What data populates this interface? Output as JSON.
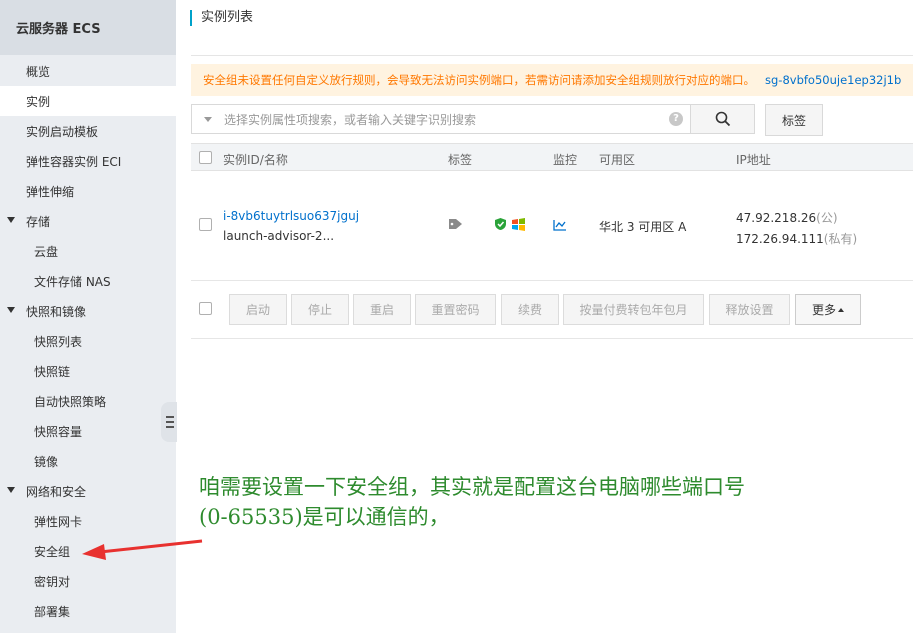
{
  "sidebar": {
    "title": "云服务器 ECS",
    "items": [
      {
        "label": "概览"
      },
      {
        "label": "实例"
      },
      {
        "label": "实例启动模板"
      },
      {
        "label": "弹性容器实例 ECI"
      },
      {
        "label": "弹性伸缩"
      },
      {
        "label": "存储"
      },
      {
        "label": "云盘"
      },
      {
        "label": "文件存储 NAS"
      },
      {
        "label": "快照和镜像"
      },
      {
        "label": "快照列表"
      },
      {
        "label": "快照链"
      },
      {
        "label": "自动快照策略"
      },
      {
        "label": "快照容量"
      },
      {
        "label": "镜像"
      },
      {
        "label": "网络和安全"
      },
      {
        "label": "弹性网卡"
      },
      {
        "label": "安全组"
      },
      {
        "label": "密钥对"
      },
      {
        "label": "部署集"
      }
    ]
  },
  "page": {
    "title": "实例列表",
    "warning": "安全组未设置任何自定义放行规则，会导致无法访问实例端口，若需访问请添加安全组规则放行对应的端口。",
    "warning_link": "sg-8vbfo50uje1ep32j1b"
  },
  "search": {
    "placeholder": "选择实例属性项搜索，或者输入关键字识别搜索",
    "help": "?",
    "tags_label": "标签"
  },
  "table": {
    "columns": {
      "id_name": "实例ID/名称",
      "tags": "标签",
      "monitor": "监控",
      "zone": "可用区",
      "ip": "IP地址"
    },
    "row": {
      "instance_id": "i-8vb6tuytrlsuo637jguj",
      "name": "launch-advisor-2...",
      "zone": "华北 3 可用区 A",
      "public_ip": "47.92.218.26",
      "public_tag": "(公)",
      "private_ip": "172.26.94.111",
      "private_tag": "(私有)"
    }
  },
  "actions": {
    "start": "启动",
    "stop": "停止",
    "restart": "重启",
    "reset_password": "重置密码",
    "renew": "续费",
    "convert_billing": "按量付费转包年包月",
    "release_settings": "释放设置",
    "more": "更多"
  },
  "annotation": {
    "line1": "咱需要设置一下安全组，其实就是配置这台电脑哪些端口号",
    "line2": "(0-65535)是可以通信的，"
  },
  "colors": {
    "accent_blue": "#0070cc",
    "warning_orange": "#ff7800",
    "annotation_green": "#2e8b2e",
    "arrow_red": "#e8312f"
  }
}
